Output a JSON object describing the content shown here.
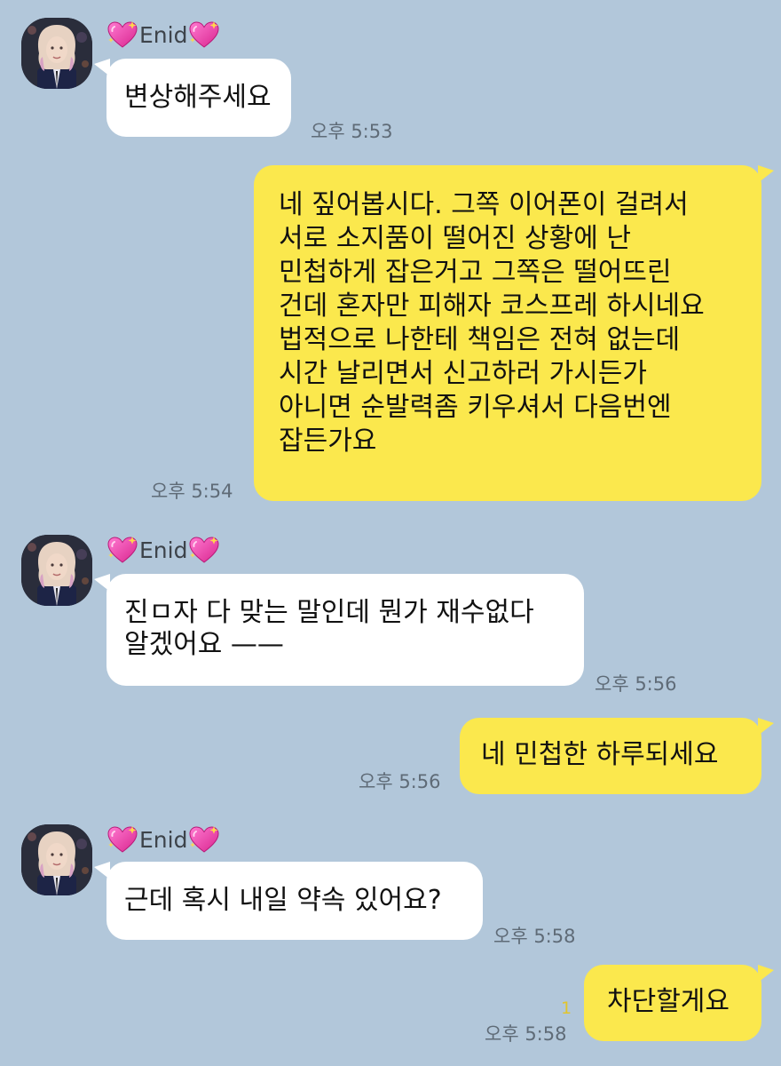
{
  "chat": {
    "partner": {
      "name": "Enid",
      "name_icon": "sparkling-heart-icon"
    },
    "colors": {
      "background": "#b2c7da",
      "incoming_bubble": "#ffffff",
      "outgoing_bubble": "#fbe84d",
      "unread_count": "#e2c52c"
    },
    "messages": [
      {
        "direction": "incoming",
        "lines": [
          "변상해주세요"
        ],
        "time": "오후 5:53"
      },
      {
        "direction": "outgoing",
        "lines": [
          "네 짚어봅시다. 그쪽 이어폰이 걸려서",
          "서로 소지품이 떨어진 상황에 난",
          "민첩하게 잡은거고 그쪽은 떨어뜨린",
          "건데 혼자만 피해자 코스프레 하시네요",
          "법적으로 나한테 책임은 전혀 없는데",
          "시간 날리면서 신고하러 가시든가",
          "아니면 순발력좀 키우셔서 다음번엔",
          "잡든가요"
        ],
        "time": "오후 5:54"
      },
      {
        "direction": "incoming",
        "lines": [
          "진ㅁ자 다 맞는 말인데 뭔가 재수없다",
          "알겠어요 ——"
        ],
        "time": "오후 5:56"
      },
      {
        "direction": "outgoing",
        "lines": [
          "네 민첩한 하루되세요"
        ],
        "time": "오후 5:56"
      },
      {
        "direction": "incoming",
        "lines": [
          "근데 혹시 내일 약속 있어요?"
        ],
        "time": "오후 5:58"
      },
      {
        "direction": "outgoing",
        "lines": [
          "차단할게요"
        ],
        "time": "오후 5:58",
        "unread_count": "1"
      }
    ]
  }
}
